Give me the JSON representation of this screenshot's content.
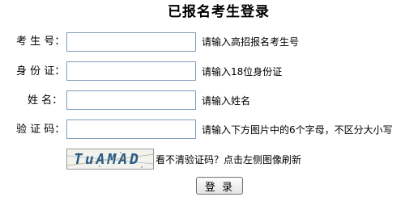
{
  "page_title": "已报名考生登录",
  "form": {
    "exam_number": {
      "label": "考 生 号：",
      "value": "",
      "hint": "请输入高招报名考生号"
    },
    "id_card": {
      "label": "身 份 证：",
      "value": "",
      "hint": "请输入18位身份证"
    },
    "name": {
      "label": "姓 名：",
      "value": "",
      "hint": "请输入姓名"
    },
    "captcha": {
      "label": "验 证 码：",
      "value": "",
      "hint": "请输入下方图片中的6个字母，不区分大小写"
    }
  },
  "captcha_image": {
    "text": "TuAMAD"
  },
  "refresh_hint": "看不清验证码？点击左侧图像刷新",
  "submit_label": "登 录"
}
